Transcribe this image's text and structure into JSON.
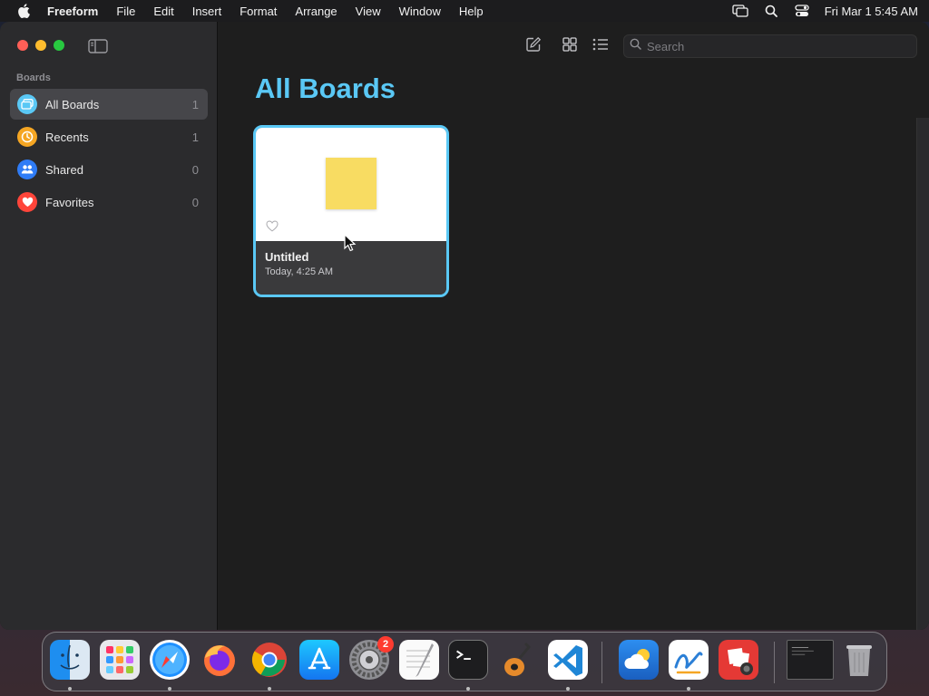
{
  "menubar": {
    "apple_icon": "apple-logo-icon",
    "app_name": "Freeform",
    "menus": [
      "File",
      "Edit",
      "Insert",
      "Format",
      "Arrange",
      "View",
      "Window",
      "Help"
    ],
    "status_icons": [
      "screen-mirroring-icon",
      "spotlight-search-icon",
      "control-center-icon"
    ],
    "clock": "Fri Mar 1  5:45 AM"
  },
  "sidebar": {
    "heading": "Boards",
    "items": [
      {
        "label": "All Boards",
        "count": "1",
        "icon": "all-boards-icon",
        "color": "#5ac8f5",
        "selected": true
      },
      {
        "label": "Recents",
        "count": "1",
        "icon": "clock-icon",
        "color": "#f5a623",
        "selected": false
      },
      {
        "label": "Shared",
        "count": "0",
        "icon": "people-icon",
        "color": "#2f7cf6",
        "selected": false
      },
      {
        "label": "Favorites",
        "count": "0",
        "icon": "heart-icon",
        "color": "#ff453a",
        "selected": false
      }
    ]
  },
  "toolbar": {
    "new_board_icon": "compose-icon",
    "grid_view_icon": "grid-view-icon",
    "list_view_icon": "list-view-icon",
    "search_placeholder": "Search",
    "search_value": ""
  },
  "main": {
    "title": "All Boards",
    "title_color": "#5ac8f5",
    "boards": [
      {
        "title": "Untitled",
        "date": "Today, 4:25 AM",
        "favorite": false
      }
    ]
  },
  "dock": {
    "apps": [
      {
        "name": "finder-icon",
        "running": true
      },
      {
        "name": "launchpad-icon",
        "running": false
      },
      {
        "name": "safari-icon",
        "running": true
      },
      {
        "name": "firefox-icon",
        "running": false
      },
      {
        "name": "chrome-icon",
        "running": true
      },
      {
        "name": "app-store-icon",
        "running": false
      },
      {
        "name": "system-settings-icon",
        "running": false,
        "badge": "2"
      },
      {
        "name": "textedit-icon",
        "running": false
      },
      {
        "name": "terminal-icon",
        "running": true
      },
      {
        "name": "garageband-icon",
        "running": false
      },
      {
        "name": "vscode-icon",
        "running": true
      },
      {
        "name": "weather-icon",
        "running": false
      },
      {
        "name": "freeform-icon",
        "running": true
      },
      {
        "name": "photo-booth-icon",
        "running": false
      },
      {
        "name": "minimized-window-icon",
        "running": false
      },
      {
        "name": "trash-icon",
        "running": false
      }
    ]
  }
}
